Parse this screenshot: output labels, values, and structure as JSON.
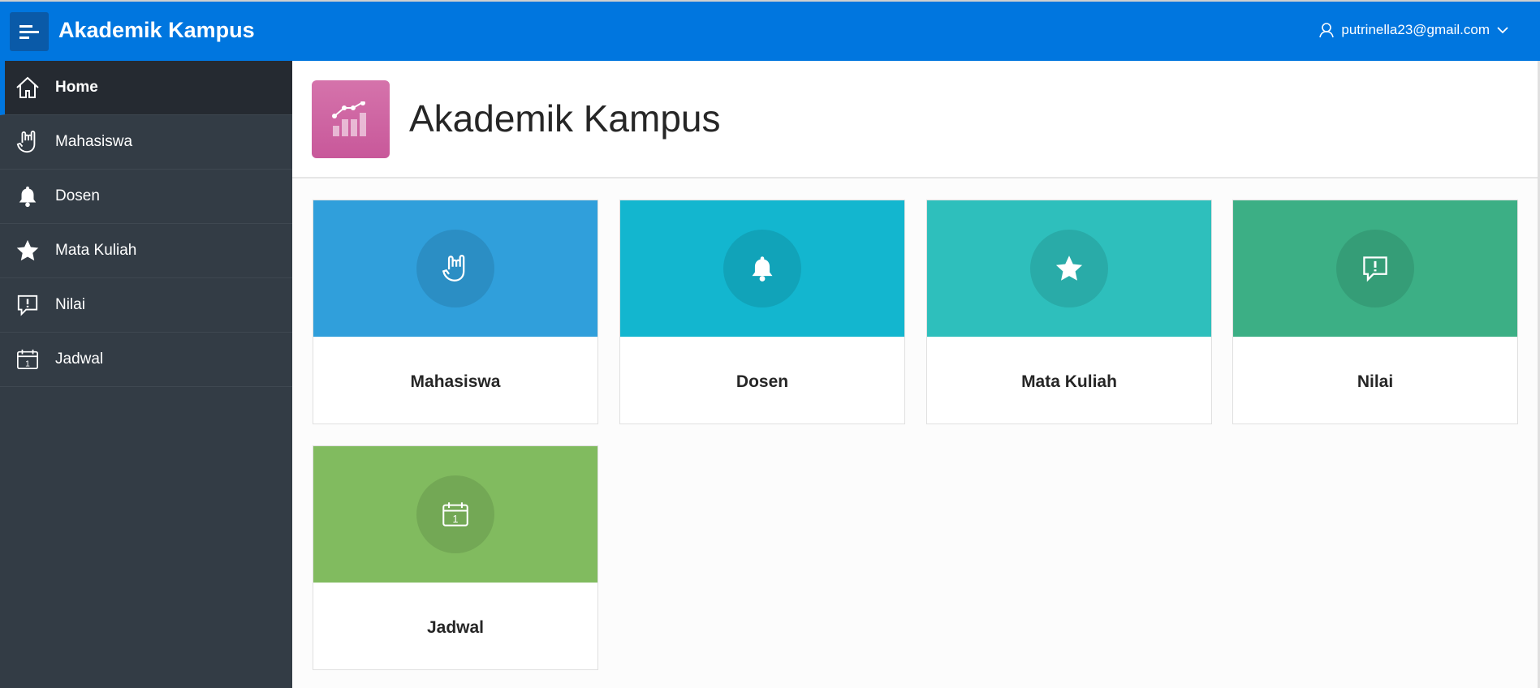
{
  "header": {
    "title": "Akademik Kampus",
    "user_email": "putrinella23@gmail.com",
    "menu_icon": "hamburger-icon",
    "user_icon": "user-icon"
  },
  "sidebar": {
    "items": [
      {
        "label": "Home",
        "icon": "home-icon",
        "active": true
      },
      {
        "label": "Mahasiswa",
        "icon": "hand-rock-icon"
      },
      {
        "label": "Dosen",
        "icon": "bell-icon"
      },
      {
        "label": "Mata Kuliah",
        "icon": "star-icon"
      },
      {
        "label": "Nilai",
        "icon": "comment-alert-icon"
      },
      {
        "label": "Jadwal",
        "icon": "calendar-icon"
      }
    ]
  },
  "hero": {
    "title": "Akademik Kampus",
    "icon": "chart-icon",
    "color": "#cf66a3"
  },
  "cards": [
    {
      "label": "Mahasiswa",
      "color": "#309fdb",
      "icon": "hand-rock-icon"
    },
    {
      "label": "Dosen",
      "color": "#13b6cf",
      "icon": "bell-icon"
    },
    {
      "label": "Mata Kuliah",
      "color": "#2ebfbc",
      "icon": "star-icon"
    },
    {
      "label": "Nilai",
      "color": "#3caf85",
      "icon": "comment-alert-icon"
    },
    {
      "label": "Jadwal",
      "color": "#81bb5f",
      "icon": "calendar-icon"
    }
  ],
  "colors": {
    "header": "#0076df",
    "sidebar": "#333c45",
    "sidebar_active": "#252a31"
  }
}
